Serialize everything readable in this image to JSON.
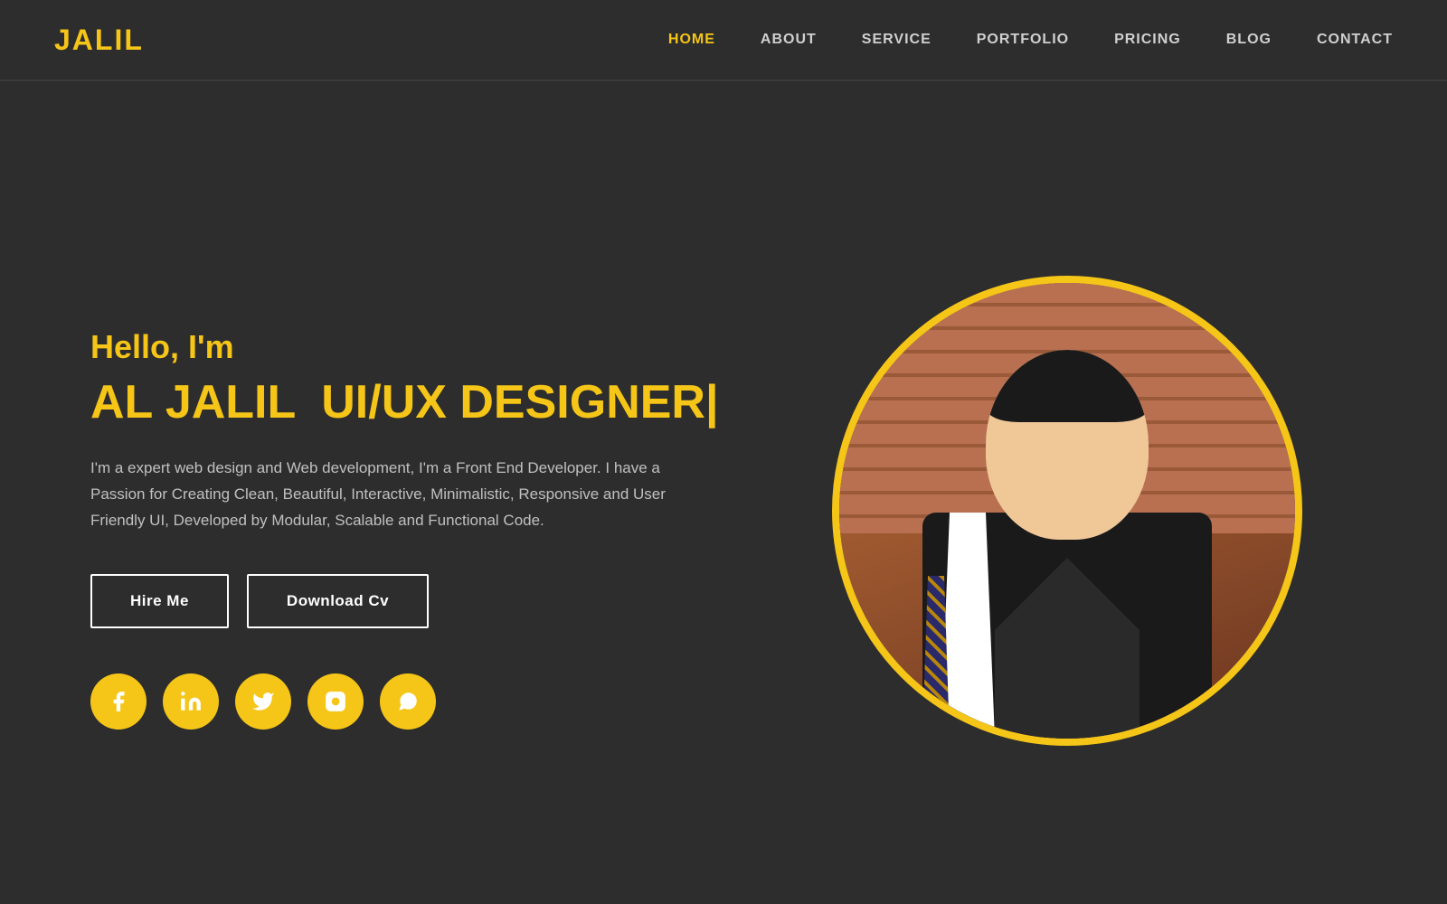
{
  "brand": {
    "logo": "JALIL"
  },
  "nav": {
    "links": [
      {
        "label": "HOME",
        "active": true,
        "id": "home"
      },
      {
        "label": "ABOUT",
        "active": false,
        "id": "about"
      },
      {
        "label": "SERVICE",
        "active": false,
        "id": "service"
      },
      {
        "label": "PORTFOLIO",
        "active": false,
        "id": "portfolio"
      },
      {
        "label": "PRICING",
        "active": false,
        "id": "pricing"
      },
      {
        "label": "BLOG",
        "active": false,
        "id": "blog"
      },
      {
        "label": "CONTACT",
        "active": false,
        "id": "contact"
      }
    ]
  },
  "hero": {
    "greeting": "Hello, I'm",
    "name": "AL JALIL",
    "title": "UI/UX DESIGNER|",
    "description": "I'm a expert web design and Web development, I'm a Front End Developer. I have a Passion for Creating Clean, Beautiful, Interactive, Minimalistic, Responsive and User Friendly UI, Developed by Modular, Scalable and Functional Code.",
    "hire_btn": "Hire Me",
    "cv_btn": "Download Cv"
  },
  "social": {
    "icons": [
      {
        "name": "facebook",
        "label": "Facebook"
      },
      {
        "name": "linkedin",
        "label": "LinkedIn"
      },
      {
        "name": "twitter",
        "label": "Twitter"
      },
      {
        "name": "instagram",
        "label": "Instagram"
      },
      {
        "name": "whatsapp",
        "label": "WhatsApp"
      }
    ]
  },
  "colors": {
    "accent": "#f5c518",
    "bg": "#2d2d2d",
    "text": "#ffffff",
    "muted": "#c0c0c0"
  }
}
